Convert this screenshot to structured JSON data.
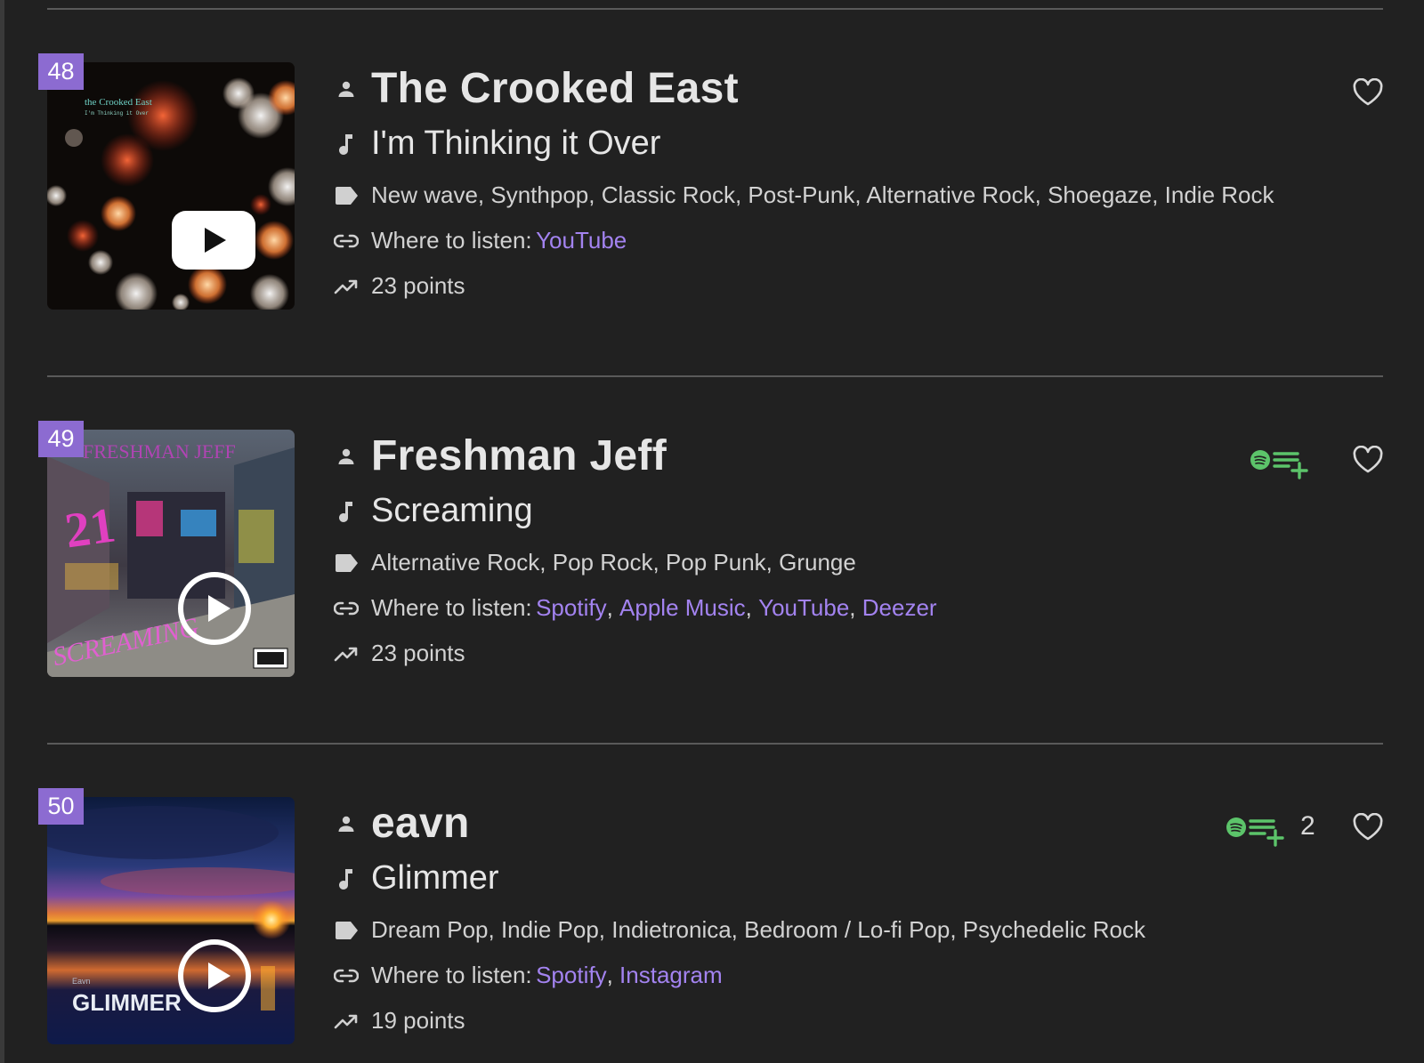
{
  "entries": [
    {
      "rank": "48",
      "artist": "The Crooked East",
      "song": "I'm Thinking it Over",
      "genres": "New wave, Synthpop, Classic Rock, Post-Punk, Alternative Rock, Shoegaze, Indie Rock",
      "listen_label": "Where to listen:",
      "links": [
        "YouTube"
      ],
      "points": "23 points",
      "cover_text_line1": "the Crooked East",
      "cover_text_line2": "I'm Thinking it Over",
      "play_style": "youtube"
    },
    {
      "rank": "49",
      "artist": "Freshman Jeff",
      "song": "Screaming",
      "genres": "Alternative Rock, Pop Rock, Pop Punk, Grunge",
      "listen_label": "Where to listen:",
      "links": [
        "Spotify",
        "Apple Music",
        "YouTube",
        "Deezer"
      ],
      "points": "23 points",
      "cover_text_line1": "FRESHMAN JEFF",
      "cover_text_line2": "SCREAMING",
      "cover_text_line3": "21",
      "play_style": "circle"
    },
    {
      "rank": "50",
      "artist": "eavn",
      "song": "Glimmer",
      "genres": "Dream Pop, Indie Pop, Indietronica, Bedroom / Lo-fi Pop, Psychedelic Rock",
      "listen_label": "Where to listen:",
      "links": [
        "Spotify",
        "Instagram"
      ],
      "points": "19 points",
      "like_count": "2",
      "cover_text_line1": "Eavn",
      "cover_text_line2": "GLIMMER",
      "play_style": "circle"
    }
  ],
  "icons": {
    "artist": "person-icon",
    "song": "music-note-icon",
    "genre": "tag-icon",
    "listen": "link-icon",
    "points": "trending-up-icon",
    "favorite": "heart-icon",
    "playlist_add": "spotify-playlist-add-icon"
  },
  "colors": {
    "background": "#212121",
    "rank_badge": "#8c6bd1",
    "link": "#a383f0",
    "spotify_green": "#5cc46a",
    "text": "#d2d2d2"
  }
}
